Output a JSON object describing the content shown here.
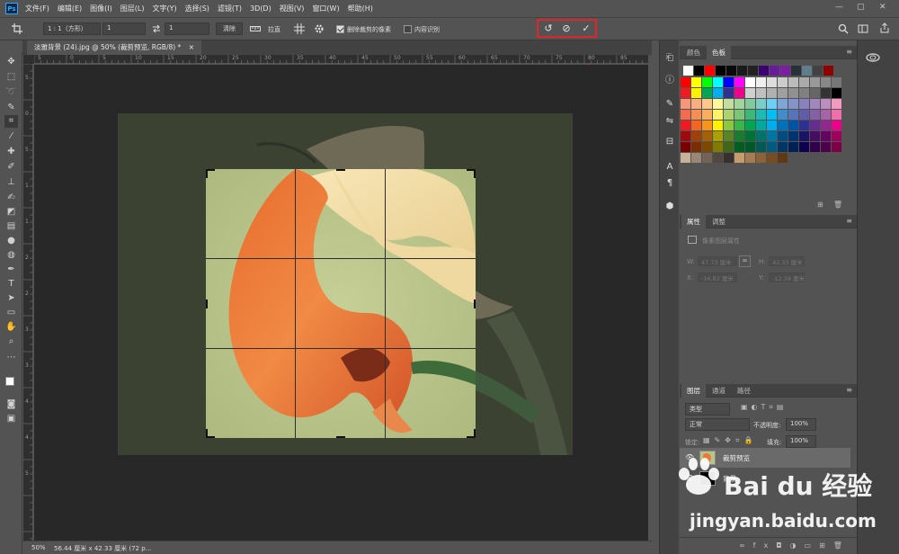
{
  "menubar": {
    "logo": "Ps",
    "items": [
      "文件(F)",
      "编辑(E)",
      "图像(I)",
      "图层(L)",
      "文字(Y)",
      "选择(S)",
      "滤镜(T)",
      "3D(D)",
      "视图(V)",
      "窗口(W)",
      "帮助(H)"
    ],
    "minimize": "—",
    "maximize": "▢",
    "close": "✕"
  },
  "options": {
    "ratio": "1 : 1（方形）",
    "width_value": "1",
    "height_value": "1",
    "clear_label": "清除",
    "straighten_label": "拉直",
    "delete_cropped_label": "删除裁剪的像素",
    "delete_cropped_checked": true,
    "content_aware_label": "内容识别",
    "content_aware_checked": false,
    "reset_glyph": "↺",
    "cancel_glyph": "⊘",
    "commit_glyph": "✓"
  },
  "document": {
    "tab_title": "淡雅背景 (24).jpg @ 50% (裁剪预览, RGB/8) *",
    "tab_close": "×",
    "ruler_h_labels": [
      "5",
      "0",
      "5",
      "10",
      "15",
      "20",
      "25",
      "30",
      "35",
      "40",
      "45",
      "50",
      "55",
      "60",
      "65",
      "70",
      "75",
      "80",
      "85"
    ],
    "ruler_v_labels": [
      "5",
      "0",
      "5",
      "1",
      "1",
      "2",
      "2",
      "3",
      "3",
      "4",
      "4",
      "5"
    ]
  },
  "status": {
    "zoom": "50%",
    "doc_size": "56.44 厘米 x 42.33 厘米 (72 p..."
  },
  "color_panel": {
    "tabs": [
      "颜色",
      "色板"
    ],
    "active_tab": "色板"
  },
  "properties_panel": {
    "tabs": [
      "属性",
      "调整"
    ],
    "subtitle": "像素图层属性",
    "w_label": "W:",
    "w_value": "47.73 厘米",
    "h_label": "H:",
    "h_value": "42.33 厘米",
    "x_label": "X:",
    "x_value": "-16.82 厘米",
    "y_label": "Y:",
    "y_value": "-12.38 厘米"
  },
  "layers_panel": {
    "tabs": [
      "图层",
      "通道",
      "路径"
    ],
    "kind_filter": "类型",
    "blend_mode": "正常",
    "opacity_label": "不透明度:",
    "opacity_value": "100%",
    "lock_label": "锁定:",
    "fill_label": "填充:",
    "fill_value": "100%",
    "layers": [
      {
        "name": "裁剪预览",
        "selected": true
      },
      {
        "name": "背景",
        "selected": false
      }
    ]
  },
  "watermark": {
    "brand": "Bai du 经验",
    "url": "jingyan.baidu.com"
  },
  "colors": {
    "accent_red": "#e0262a",
    "bg_dark": "#282828",
    "panel": "#535353"
  }
}
